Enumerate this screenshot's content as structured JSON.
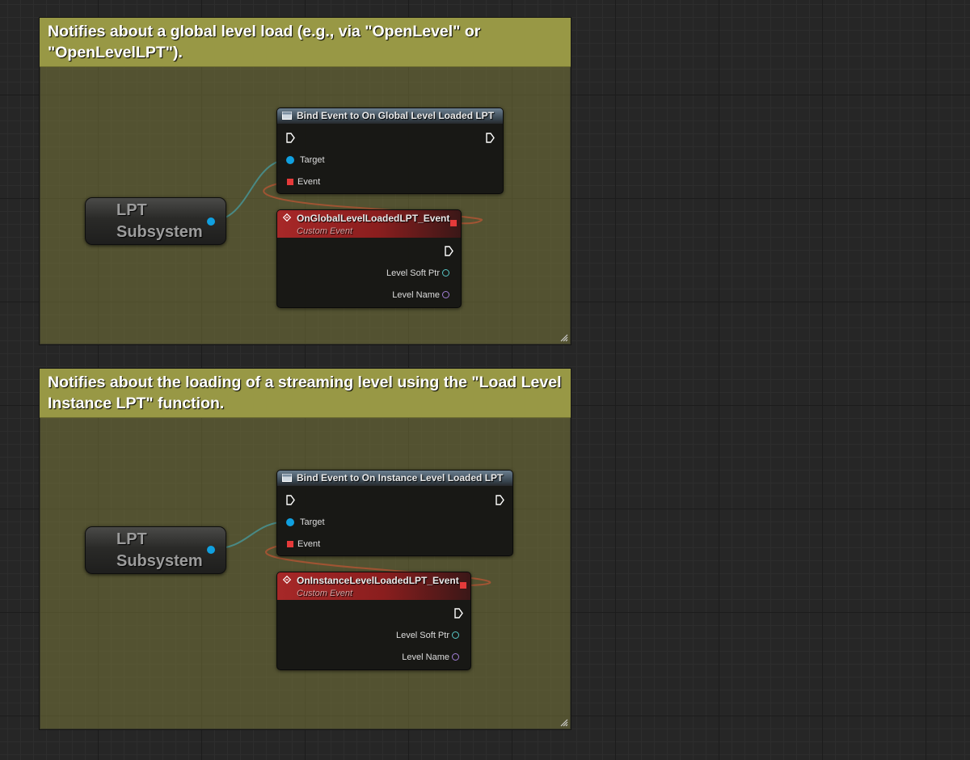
{
  "comments": [
    {
      "title": "Notifies about a global level load (e.g., via \"OpenLevel\" or \"OpenLevelLPT\").",
      "subsystem_label": "LPT\nSubsystem",
      "bind_node": {
        "title": "Bind Event to On Global Level Loaded LPT",
        "pins": {
          "target": "Target",
          "event": "Event"
        }
      },
      "event_node": {
        "title": "OnGlobalLevelLoadedLPT_Event",
        "subtitle": "Custom Event",
        "outputs": {
          "soft_ptr": "Level Soft Ptr",
          "name": "Level Name"
        }
      }
    },
    {
      "title": "Notifies about the loading of a streaming level using the \"Load Level Instance LPT\" function.",
      "subsystem_label": "LPT\nSubsystem",
      "bind_node": {
        "title": "Bind Event to On Instance Level Loaded LPT",
        "pins": {
          "target": "Target",
          "event": "Event"
        }
      },
      "event_node": {
        "title": "OnInstanceLevelLoadedLPT_Event",
        "subtitle": "Custom Event",
        "outputs": {
          "soft_ptr": "Level Soft Ptr",
          "name": "Level Name"
        }
      }
    }
  ],
  "colors": {
    "comment_bar": "#989845",
    "object_pin": "#00a0ff",
    "delegate_pin": "#e63a3a",
    "soft_object_pin": "#58c7c7",
    "name_pin": "#a27fd6",
    "exec_pin": "#ffffff"
  },
  "icons": {
    "bind_node": "function-icon",
    "event_node": "event-diamond-icon",
    "comment_resize": "resize-grip-icon"
  }
}
